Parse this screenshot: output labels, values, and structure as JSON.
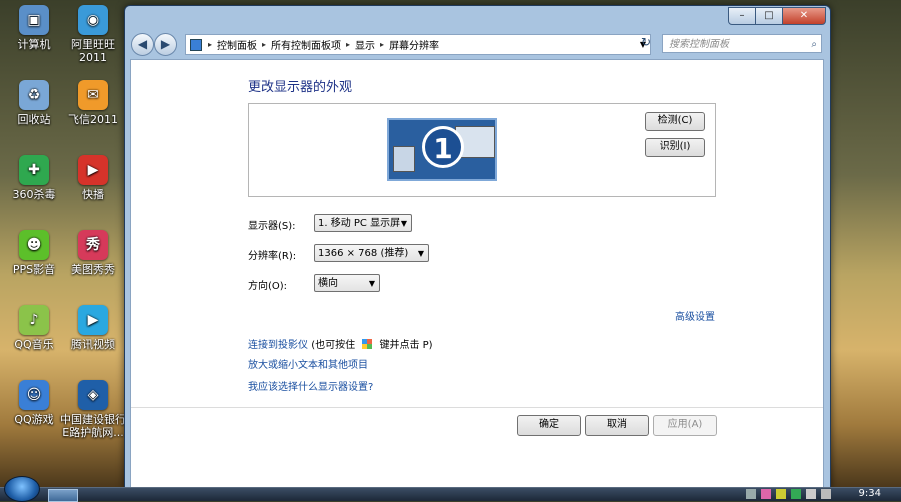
{
  "desktop": {
    "icons": [
      {
        "label": "计算机",
        "name": "computer-icon",
        "color": "#5a8fc8",
        "glyph": "▣"
      },
      {
        "label": "阿里旺旺\n2011",
        "name": "aliwangwang-icon",
        "color": "#3a9ad9",
        "glyph": "◉"
      },
      {
        "label": "回收站",
        "name": "recycle-bin-icon",
        "color": "#7aa7d6",
        "glyph": "♻"
      },
      {
        "label": "飞信2011",
        "name": "fetion-icon",
        "color": "#f09a2a",
        "glyph": "✉"
      },
      {
        "label": "360杀毒",
        "name": "antivirus-360-icon",
        "color": "#2fa84f",
        "glyph": "✚"
      },
      {
        "label": "快播",
        "name": "kuaibo-icon",
        "color": "#d6332a",
        "glyph": "▶"
      },
      {
        "label": "PPS影音",
        "name": "pps-icon",
        "color": "#5cbf2a",
        "glyph": "☻"
      },
      {
        "label": "美图秀秀",
        "name": "meitu-icon",
        "color": "#d63a5a",
        "glyph": "秀"
      },
      {
        "label": "QQ音乐",
        "name": "qq-music-icon",
        "color": "#8bc34a",
        "glyph": "♪"
      },
      {
        "label": "腾讯视频",
        "name": "tencent-video-icon",
        "color": "#2aa8e0",
        "glyph": "▶"
      },
      {
        "label": "QQ游戏",
        "name": "qq-game-icon",
        "color": "#3a7fd6",
        "glyph": "☺"
      },
      {
        "label": "中国建设银行\nE路护航网...",
        "name": "ccb-icon",
        "color": "#1f5fa8",
        "glyph": "◈"
      }
    ]
  },
  "window": {
    "controls": {
      "minimize": "–",
      "maximize": "□",
      "close": "✕"
    },
    "address": {
      "segments": [
        "控制面板",
        "所有控制面板项",
        "显示",
        "屏幕分辨率"
      ],
      "separator": "▸"
    },
    "search_placeholder": "搜索控制面板",
    "heading": "更改显示器的外观",
    "monitor_number": "1",
    "detect_label": "检测(C)",
    "identify_label": "识别(I)",
    "display_label": "显示器(S):",
    "display_value": "1. 移动 PC 显示屏",
    "resolution_label": "分辨率(R):",
    "resolution_value": "1366 × 768 (推荐)",
    "orientation_label": "方向(O):",
    "orientation_value": "横向",
    "advanced_link": "高级设置",
    "projector_link": "连接到投影仪",
    "projector_hint_pre": "(也可按住",
    "projector_hint_post": "键并点击 P)",
    "text_size_link": "放大或缩小文本和其他项目",
    "which_settings_link": "我应该选择什么显示器设置?",
    "ok_label": "确定",
    "cancel_label": "取消",
    "apply_label": "应用(A)"
  },
  "taskbar": {
    "clock": "9:34"
  }
}
